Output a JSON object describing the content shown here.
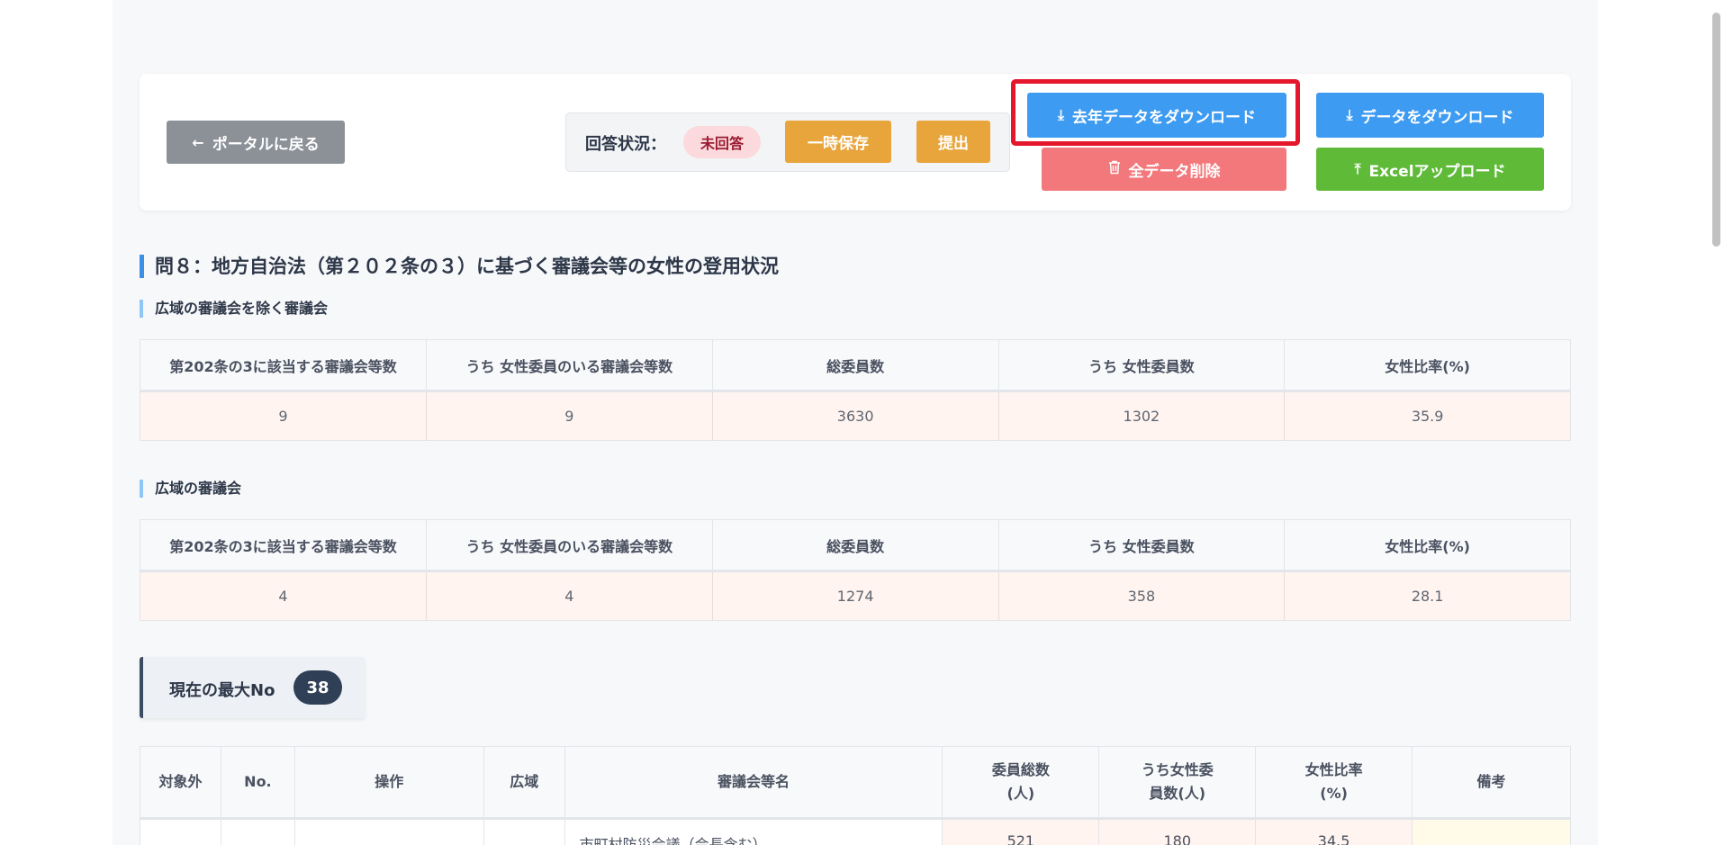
{
  "toolbar": {
    "back_label": "ポータルに戻る",
    "status_label": "回答状況：",
    "status_value": "未回答",
    "save_label": "一時保存",
    "submit_label": "提出",
    "last_year_download_label": "去年データをダウンロード",
    "delete_all_label": "全データ削除",
    "download_label": "データをダウンロード",
    "excel_upload_label": "Excelアップロード"
  },
  "question": {
    "title": "問８：地方自治法（第２０２条の３）に基づく審議会等の女性の登用状況"
  },
  "summary_tables": [
    {
      "title": "広域の審議会を除く審議会",
      "headers": [
        "第202条の3に該当する審議会等数",
        "うち 女性委員のいる審議会等数",
        "総委員数",
        "うち 女性委員数",
        "女性比率(%)"
      ],
      "values": [
        "9",
        "9",
        "3630",
        "1302",
        "35.9"
      ]
    },
    {
      "title": "広域の審議会",
      "headers": [
        "第202条の3に該当する審議会等数",
        "うち 女性委員のいる審議会等数",
        "総委員数",
        "うち 女性委員数",
        "女性比率(%)"
      ],
      "values": [
        "4",
        "4",
        "1274",
        "358",
        "28.1"
      ]
    }
  ],
  "max_no": {
    "label": "現在の最大No",
    "value": "38"
  },
  "main_table": {
    "headers": {
      "excluded": "対象外",
      "no": "No.",
      "action": "操作",
      "wide_area": "広域",
      "council_name": "審議会等名",
      "total_members_line1": "委員総数",
      "total_members_line2": "(人)",
      "female_members_line1": "うち女性委",
      "female_members_line2": "員数(人)",
      "female_ratio_line1": "女性比率",
      "female_ratio_line2": "(%)",
      "remarks": "備考"
    },
    "rows": [
      {
        "council_name": "市町村防災会議（会長含む）",
        "total_members": "521",
        "female_members": "180",
        "female_ratio": "34.5"
      }
    ]
  },
  "colors": {
    "primary_blue": "#3d9bf1",
    "orange": "#e8a53c",
    "danger_red": "#f3787b",
    "success_green": "#5fba38",
    "highlight_red": "#e4172c"
  },
  "icons": {
    "back": "arrow-left-icon",
    "download": "download-icon",
    "delete": "trash-icon",
    "upload": "upload-icon"
  }
}
